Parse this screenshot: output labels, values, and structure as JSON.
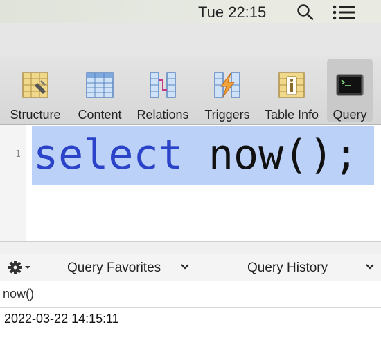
{
  "menubar": {
    "clock": "Tue 22:15"
  },
  "toolbar": {
    "items": [
      {
        "label": "Structure"
      },
      {
        "label": "Content"
      },
      {
        "label": "Relations"
      },
      {
        "label": "Triggers"
      },
      {
        "label": "Table Info"
      },
      {
        "label": "Query",
        "active": true
      }
    ]
  },
  "editor": {
    "line_number": "1",
    "keyword": "select",
    "rest": " now();"
  },
  "query_bar": {
    "favorites_label": "Query Favorites",
    "history_label": "Query History"
  },
  "results": {
    "columns": [
      "now()"
    ],
    "rows": [
      [
        "2022-03-22 14:15:11"
      ]
    ]
  },
  "colors": {
    "keyword": "#2b43c9",
    "selection": "#bcd1f7"
  }
}
